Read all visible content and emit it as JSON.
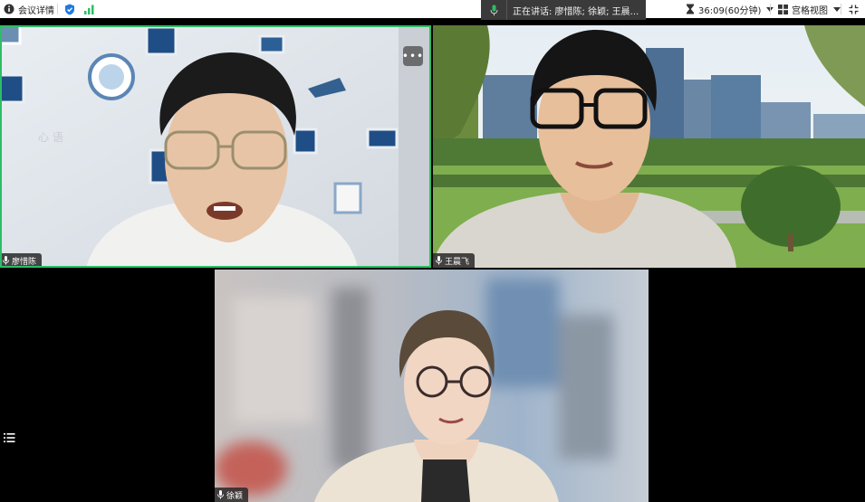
{
  "topbar": {
    "meeting_details_label": "会议详情",
    "speaking_text": "正在讲话: 廖惜陈; 徐颖; 王晨...",
    "timer_text": "36:09(60分钟)",
    "view_label": "宫格视图"
  },
  "participants": [
    {
      "name": "廖惜陈",
      "active_speaker": true,
      "more_button": "•••"
    },
    {
      "name": "王晨飞",
      "active_speaker": false
    },
    {
      "name": "徐颖",
      "active_speaker": false
    }
  ],
  "colors": {
    "active_border": "#2dbd66",
    "shield": "#1f7ae0",
    "signal": "#2dbd66",
    "topbar_bg": "#ffffff",
    "speaking_bg": "#3a3a3a"
  },
  "icons": {
    "info": "info-icon",
    "shield": "shield-check-icon",
    "signal": "signal-bars-icon",
    "mic": "microphone-icon",
    "timer": "hourglass-icon",
    "grid": "grid-view-icon",
    "fullscreen": "fullscreen-icon",
    "more": "more-icon",
    "list": "participant-list-icon"
  }
}
